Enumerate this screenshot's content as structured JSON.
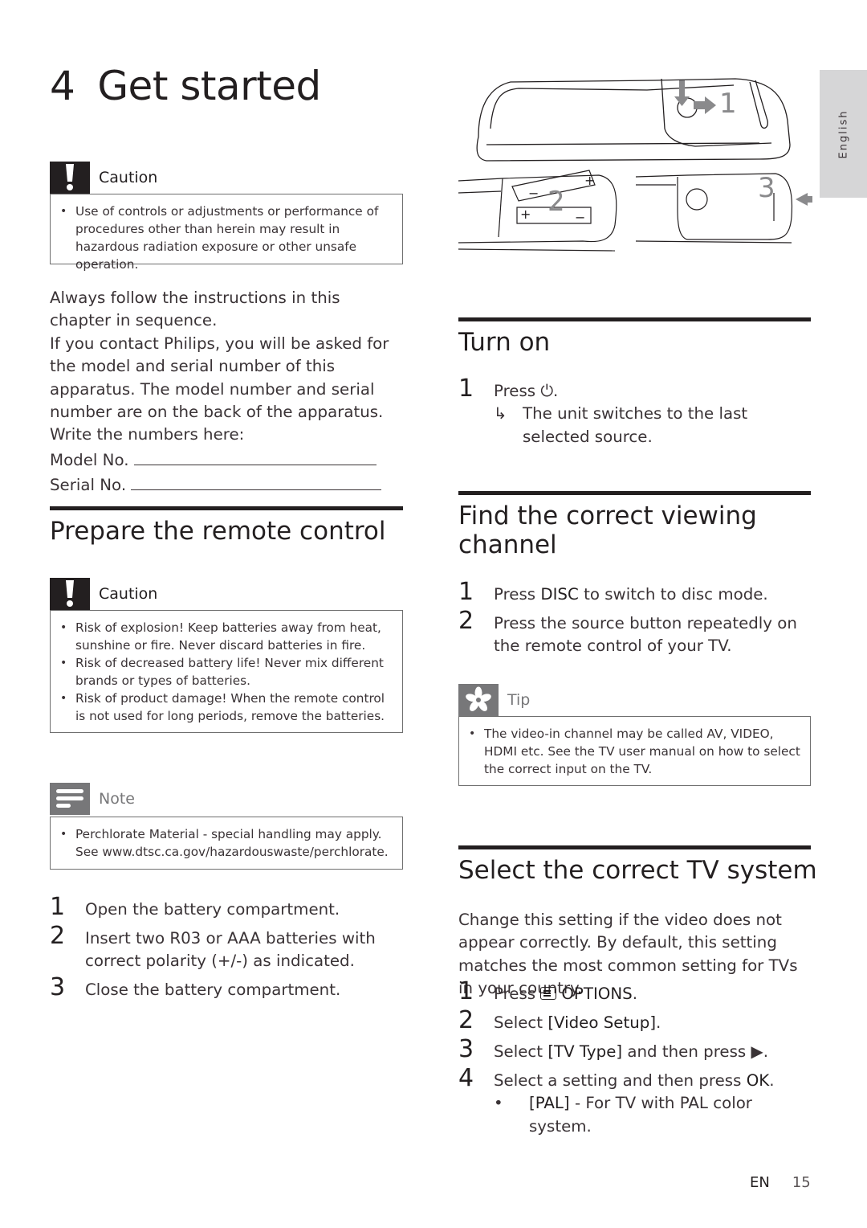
{
  "language_tab": "English",
  "chapter": {
    "number": "4",
    "title": "Get started"
  },
  "caution_top": {
    "label": "Caution",
    "icon": "exclamation-icon",
    "items": [
      "Use of controls or adjustments or performance of procedures other than herein may result in hazardous radiation exposure or other unsafe operation."
    ]
  },
  "intro": {
    "line1": "Always follow the instructions in this chapter in sequence.",
    "line2": "If you contact Philips, you will be asked for the model and serial number of this apparatus. The model number and serial number are on the back of the apparatus. Write the numbers here:",
    "model_label": "Model No.",
    "serial_label": "Serial No."
  },
  "prepare_remote": {
    "title": "Prepare the remote control",
    "caution": {
      "label": "Caution",
      "items": [
        "Risk of explosion! Keep batteries away from heat, sunshine or fire. Never discard batteries in fire.",
        "Risk of decreased battery life! Never mix different brands or types of batteries.",
        "Risk of product damage! When the remote control is not used for long periods, remove the batteries."
      ]
    },
    "note": {
      "label": "Note",
      "items": [
        "Perchlorate Material - special handling may apply. See www.dtsc.ca.gov/hazardouswaste/perchlorate."
      ]
    },
    "steps": [
      {
        "n": "1",
        "text": "Open the battery compartment."
      },
      {
        "n": "2",
        "text": "Insert two R03 or AAA batteries with correct polarity (+/-) as indicated."
      },
      {
        "n": "3",
        "text": "Close the battery compartment."
      }
    ]
  },
  "illustration": {
    "labels": [
      "1",
      "2",
      "3"
    ],
    "plus": "+",
    "minus": "−"
  },
  "turn_on": {
    "title": "Turn on",
    "steps": [
      {
        "n": "1",
        "pre": "Press ",
        "icon": "⏻",
        "post": ".",
        "result": "The unit switches to the last selected source."
      }
    ],
    "result_arrow": "↳"
  },
  "find_channel": {
    "title": "Find the correct viewing channel",
    "steps": [
      {
        "n": "1",
        "pre": "Press ",
        "key": "DISC",
        "post": " to switch to disc mode."
      },
      {
        "n": "2",
        "text": "Press the source button repeatedly on the remote control of your TV."
      }
    ],
    "tip": {
      "label": "Tip",
      "items": [
        "The video-in channel may be called AV, VIDEO, HDMI etc. See the TV user manual on how to select the correct input on the TV."
      ]
    }
  },
  "tv_system": {
    "title": "Select the correct TV system",
    "intro": "Change this setting if the video does not appear correctly. By default, this setting matches the most common setting for TVs in your country.",
    "steps": [
      {
        "n": "1",
        "pre": "Press ",
        "key": "OPTIONS",
        "post": "."
      },
      {
        "n": "2",
        "pre": "Select ",
        "key": "[Video Setup]",
        "post": "."
      },
      {
        "n": "3",
        "pre": "Select ",
        "key": "[TV Type]",
        "post": " and then press ▶."
      },
      {
        "n": "4",
        "pre": "Select a setting and then press ",
        "key": "OK",
        "post": "."
      }
    ],
    "options": [
      {
        "key": "[PAL]",
        "text": " - For TV with PAL color system."
      }
    ]
  },
  "footer": {
    "lang": "EN",
    "page": "15"
  }
}
